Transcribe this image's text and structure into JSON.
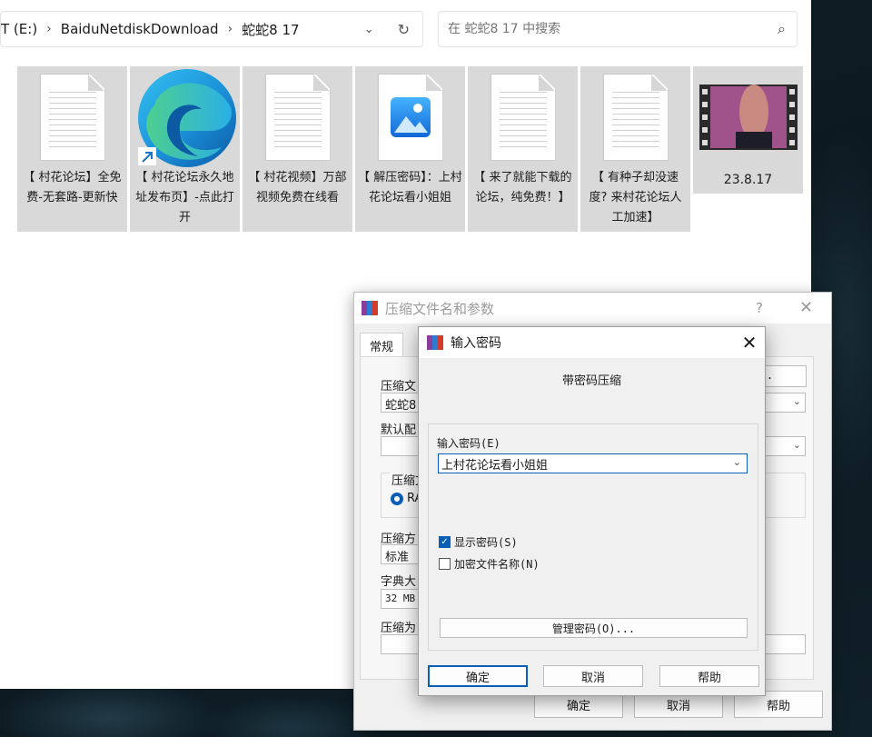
{
  "explorer": {
    "breadcrumbs": [
      "T (E:)",
      "BaiduNetdiskDownload",
      "蛇蛇8 17"
    ],
    "search_placeholder": "在 蛇蛇8 17 中搜索",
    "files": [
      {
        "name": "【 村花论坛】全免费-无套路-更新快",
        "icon": "text-document-icon"
      },
      {
        "name": "【 村花论坛永久地址发布页】-点此打开",
        "icon": "edge-shortcut-icon"
      },
      {
        "name": "【 村花视频】万部视频免费在线看",
        "icon": "text-document-icon"
      },
      {
        "name": "【 解压密码】：上村花论坛看小姐姐",
        "icon": "image-file-icon"
      },
      {
        "name": "【 来了就能下载的论坛，纯免费！】",
        "icon": "text-document-icon"
      },
      {
        "name": "【 有种子却没速度? 来村花论坛人工加速】",
        "icon": "text-document-icon"
      },
      {
        "name": "23.8.17",
        "icon": "video-file-icon"
      }
    ]
  },
  "archive_dialog": {
    "title": "压缩文件名和参数",
    "help": "?",
    "close": "✕",
    "tab_general": "常规",
    "label_archive_name": "压缩文",
    "archive_name_value": "蛇蛇8",
    "label_default_profile": "默认配",
    "browse_label": "B)...",
    "label_format": "压缩文",
    "format_rar": "RA",
    "label_method": "压缩方",
    "method_value": "标准",
    "label_dict": "字典大",
    "dict_value": "32 MB",
    "label_split": "压缩为",
    "ok_label": "确定",
    "cancel_label": "取消",
    "help_label": "帮助"
  },
  "password_dialog": {
    "title": "输入密码",
    "close": "✕",
    "heading": "带密码压缩",
    "password_label": "输入密码(E)",
    "password_value": "上村花论坛看小姐姐",
    "show_password_label": "显示密码(S)",
    "show_password_checked": true,
    "encrypt_names_label": "加密文件名称(N)",
    "encrypt_names_checked": false,
    "manage_label": "管理密码(O)...",
    "ok_label": "确定",
    "cancel_label": "取消",
    "help_label": "帮助"
  },
  "colors": {
    "accent": "#0a5eb8",
    "tile_bg": "#d9d9d9",
    "dialog_bg": "#f0f0f0"
  }
}
